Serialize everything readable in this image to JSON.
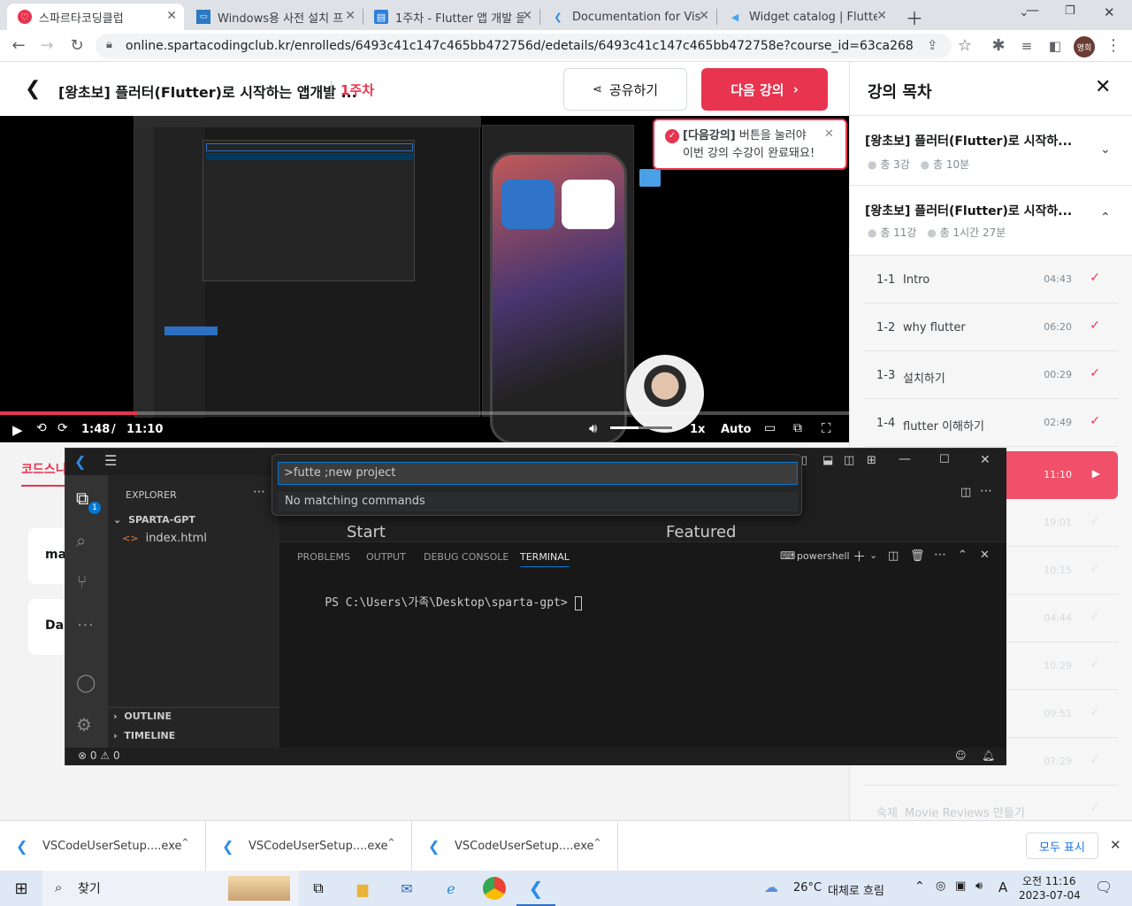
{
  "browser": {
    "tabs": [
      {
        "title": "스파르타코딩클럽",
        "active": true
      },
      {
        "title": "Windows용 사전 설치 프"
      },
      {
        "title": "1주차 - Flutter 앱 개발 을"
      },
      {
        "title": "Documentation for Visua"
      },
      {
        "title": "Widget catalog | Flutter"
      }
    ],
    "url": "online.spartacodingclub.kr/enrolleds/6493c41c147c465bb472756d/edetails/6493c41c147c465bb472758e?course_id=63ca26845b3bac30b29...",
    "profile": "명희"
  },
  "header": {
    "course_title": "[왕초보] 플러터(Flutter)로 시작하는 앱개발 ...",
    "week": "1주차",
    "share_label": "공유하기",
    "next_label": "다음 강의"
  },
  "tooltip": {
    "bold": "[다음강의]",
    "line1_rest": " 버튼을 눌러야",
    "line2": "이번 강의 수강이 완료돼요!"
  },
  "video": {
    "current_time": "1:48",
    "separator": "/",
    "duration": "11:10",
    "speed": "1x",
    "quality": "Auto",
    "progress": 0.161
  },
  "sidebar": {
    "title": "강의 목차",
    "sections": [
      {
        "title": "[왕초보] 플러터(Flutter)로 시작하...",
        "count": "총 3강",
        "duration": "총 10분"
      },
      {
        "title": "[왕초보] 플러터(Flutter)로 시작하...",
        "count": "총 11강",
        "duration": "총 1시간 27분"
      }
    ],
    "lessons": [
      {
        "num": "1-1",
        "name": "Intro",
        "time": "04:43"
      },
      {
        "num": "1-2",
        "name": "why flutter",
        "time": "06:20"
      },
      {
        "num": "1-3",
        "name": "설치하기",
        "time": "00:29"
      },
      {
        "num": "1-4",
        "name": "flutter 이해하기",
        "time": "02:49"
      },
      {
        "num": "",
        "name": "",
        "time": "11:10"
      },
      {
        "num": "",
        "name": "",
        "time": "19:01"
      },
      {
        "num": "",
        "name": "",
        "time": "10:15"
      },
      {
        "num": "",
        "name": "",
        "time": "04:44"
      },
      {
        "num": "",
        "name": "",
        "time": "10:29"
      },
      {
        "num": "",
        "name": "",
        "time": "09:51"
      },
      {
        "num": "",
        "name": "",
        "time": "07:29"
      },
      {
        "num": "숙제",
        "name": "Movie Reviews 만들기",
        "time": ""
      }
    ]
  },
  "page_behind": {
    "tab_label": "코드스니",
    "card1": "ma",
    "card2": "Da"
  },
  "vscode": {
    "palette_input": ">futte ;new project",
    "palette_result": "No matching commands",
    "explorer_title": "EXPLORER",
    "folder": "SPARTA-GPT",
    "file": "index.html",
    "outline": "OUTLINE",
    "timeline": "TIMELINE",
    "editor_start": "Start",
    "editor_featured": "Featured",
    "panel_tabs": [
      "PROBLEMS",
      "OUTPUT",
      "DEBUG CONSOLE",
      "TERMINAL"
    ],
    "terminal_shell": "powershell",
    "terminal_prompt": "PS C:\\Users\\가족\\Desktop\\sparta-gpt> ",
    "status_errors": "0",
    "status_warnings": "0",
    "badge": "1"
  },
  "downloads": {
    "items": [
      "VSCodeUserSetup....exe",
      "VSCodeUserSetup....exe",
      "VSCodeUserSetup....exe"
    ],
    "show_all": "모두 표시"
  },
  "taskbar": {
    "search": "찾기",
    "weather_temp": "26°C",
    "weather_desc": "대체로 흐림",
    "ime": "A",
    "time": "오전 11:16",
    "date": "2023-07-04"
  },
  "colors": {
    "brand": "#e8344e",
    "vscode_accent": "#0078d4"
  }
}
